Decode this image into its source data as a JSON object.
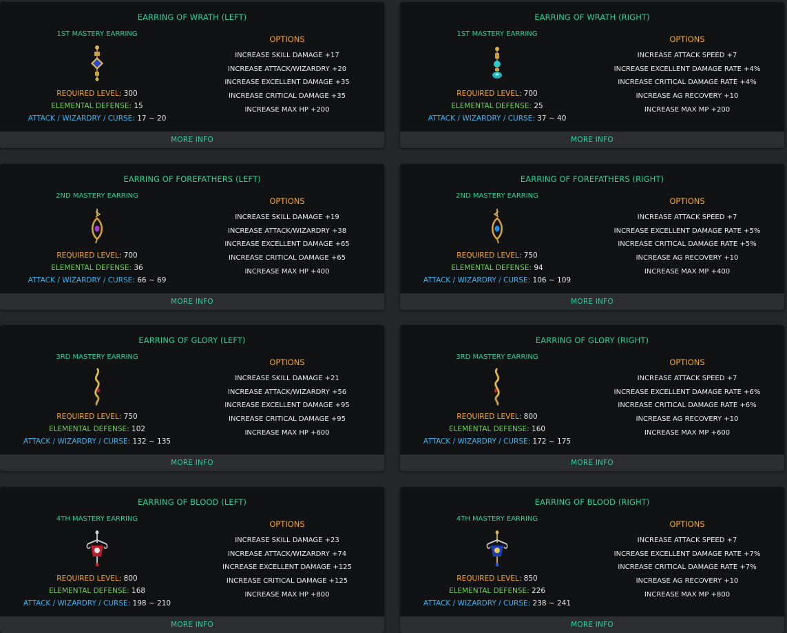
{
  "labels": {
    "required_level": "REQUIRED LEVEL:",
    "elemental_defense": "ELEMENTAL DEFENSE:",
    "attack": "ATTACK / WIZARDRY / CURSE:",
    "options_title": "OPTIONS",
    "more_info": "MORE INFO"
  },
  "colors": {
    "accent": "#27d19c",
    "required": "#f5a623",
    "elemental": "#6fcf58",
    "attack": "#38b5f2"
  },
  "cards": [
    {
      "title": "EARRING OF WRATH (LEFT)",
      "mastery": "1ST MASTERY EARRING",
      "icon": "wrath-left-earring-icon",
      "required_level": "300",
      "elemental_defense": "15",
      "attack": "17 ~ 20",
      "options": [
        "INCREASE SKILL DAMAGE +17",
        "INCREASE ATTACK/WIZARDRY +20",
        "INCREASE EXCELLENT DAMAGE +35",
        "INCREASE CRITICAL DAMAGE +35",
        "INCREASE MAX HP +200"
      ]
    },
    {
      "title": "EARRING OF WRATH (RIGHT)",
      "mastery": "1ST MASTERY EARRING",
      "icon": "wrath-right-earring-icon",
      "required_level": "700",
      "elemental_defense": "25",
      "attack": "37 ~ 40",
      "options": [
        "INCREASE ATTACK SPEED +7",
        "INCREASE EXCELLENT DAMAGE RATE +4%",
        "INCREASE CRITICAL DAMAGE RATE +4%",
        "INCREASE AG RECOVERY +10",
        "INCREASE MAX MP +200"
      ]
    },
    {
      "title": "EARRING OF FOREFATHERS (LEFT)",
      "mastery": "2ND MASTERY EARRING",
      "icon": "forefathers-left-earring-icon",
      "required_level": "700",
      "elemental_defense": "36",
      "attack": "66 ~ 69",
      "options": [
        "INCREASE SKILL DAMAGE +19",
        "INCREASE ATTACK/WIZARDRY +38",
        "INCREASE EXCELLENT DAMAGE +65",
        "INCREASE CRITICAL DAMAGE +65",
        "INCREASE MAX HP +400"
      ]
    },
    {
      "title": "EARRING OF FOREFATHERS (RIGHT)",
      "mastery": "2ND MASTERY EARRING",
      "icon": "forefathers-right-earring-icon",
      "required_level": "750",
      "elemental_defense": "94",
      "attack": "106 ~ 109",
      "options": [
        "INCREASE ATTACK SPEED +7",
        "INCREASE EXCELLENT DAMAGE RATE +5%",
        "INCREASE CRITICAL DAMAGE RATE +5%",
        "INCREASE AG RECOVERY +10",
        "INCREASE MAX MP +400"
      ]
    },
    {
      "title": "EARRING OF GLORY (LEFT)",
      "mastery": "3RD MASTERY EARRING",
      "icon": "glory-left-earring-icon",
      "required_level": "750",
      "elemental_defense": "102",
      "attack": "132 ~ 135",
      "options": [
        "INCREASE SKILL DAMAGE +21",
        "INCREASE ATTACK/WIZARDRY +56",
        "INCREASE EXCELLENT DAMAGE +95",
        "INCREASE CRITICAL DAMAGE +95",
        "INCREASE MAX HP +600"
      ]
    },
    {
      "title": "EARRING OF GLORY (RIGHT)",
      "mastery": "3RD MASTERY EARRING",
      "icon": "glory-right-earring-icon",
      "required_level": "800",
      "elemental_defense": "160",
      "attack": "172 ~ 175",
      "options": [
        "INCREASE ATTACK SPEED +7",
        "INCREASE EXCELLENT DAMAGE RATE +6%",
        "INCREASE CRITICAL DAMAGE RATE +6%",
        "INCREASE AG RECOVERY +10",
        "INCREASE MAX MP +600"
      ]
    },
    {
      "title": "EARRING OF BLOOD (LEFT)",
      "mastery": "4TH MASTERY EARRING",
      "icon": "blood-left-earring-icon",
      "required_level": "800",
      "elemental_defense": "168",
      "attack": "198 ~ 210",
      "options": [
        "INCREASE SKILL DAMAGE +23",
        "INCREASE ATTACK/WIZARDRY +74",
        "INCREASE EXCELLENT DAMAGE +125",
        "INCREASE CRITICAL DAMAGE +125",
        "INCREASE MAX HP +800"
      ]
    },
    {
      "title": "EARRING OF BLOOD (RIGHT)",
      "mastery": "4TH MASTERY EARRING",
      "icon": "blood-right-earring-icon",
      "required_level": "850",
      "elemental_defense": "226",
      "attack": "238 ~ 241",
      "options": [
        "INCREASE ATTACK SPEED +7",
        "INCREASE EXCELLENT DAMAGE RATE +7%",
        "INCREASE CRITICAL DAMAGE RATE +7%",
        "INCREASE AG RECOVERY +10",
        "INCREASE MAX MP +800"
      ]
    }
  ]
}
